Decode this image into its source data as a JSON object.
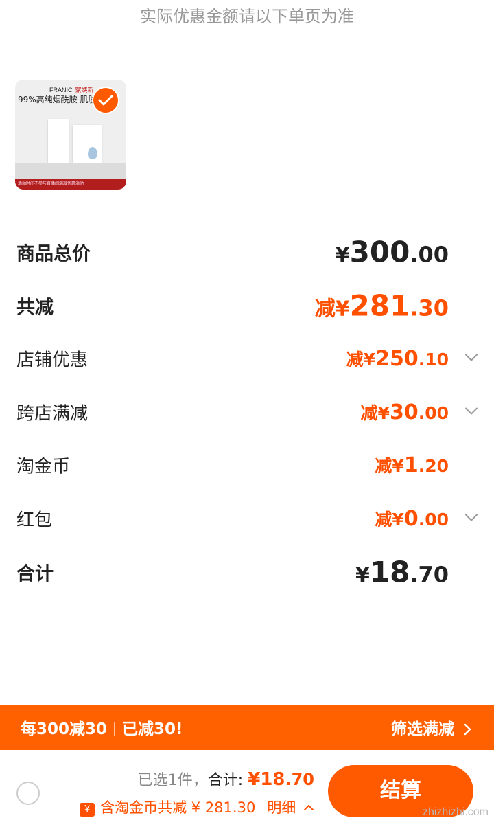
{
  "notice": "实际优惠金额请以下单页为准",
  "product_thumb": {
    "brand": "FRANIC",
    "brand_tag": "家姨新",
    "headline": "99%高纯烟酰胺 肌肤",
    "band_text": "活动时间不参与直播间满减优惠活动",
    "icon": "checkmark-icon",
    "selected": true
  },
  "price_rows": [
    {
      "label": "商品总价",
      "prefix": "",
      "symbol": "¥",
      "int": "300",
      "dec": ".00",
      "style": "black-big",
      "has_dropdown": false
    },
    {
      "label": "共减",
      "prefix": "减",
      "symbol": "¥",
      "int": "281",
      "dec": ".30",
      "style": "orange-big",
      "has_dropdown": false
    },
    {
      "label": "店铺优惠",
      "prefix": "减",
      "symbol": "¥",
      "int": "250",
      "dec": ".10",
      "style": "orange-mid",
      "has_dropdown": true
    },
    {
      "label": "跨店满减",
      "prefix": "减",
      "symbol": "¥",
      "int": "30",
      "dec": ".00",
      "style": "orange-mid",
      "has_dropdown": true
    },
    {
      "label": "淘金币",
      "prefix": "减",
      "symbol": "¥",
      "int": "1",
      "dec": ".20",
      "style": "orange-mid",
      "has_dropdown": false
    },
    {
      "label": "红包",
      "prefix": "减",
      "symbol": "¥",
      "int": "0",
      "dec": ".00",
      "style": "orange-mid",
      "has_dropdown": true
    },
    {
      "label": "合计",
      "prefix": "",
      "symbol": "¥",
      "int": "18",
      "dec": ".70",
      "style": "black-big",
      "has_dropdown": false
    }
  ],
  "promo_bar": {
    "left_1": "每300减30",
    "left_2": "已减30!",
    "right": "筛选满减",
    "right_icon": "chevron-right-icon",
    "color": "#ff6000"
  },
  "footer": {
    "selected_text": "已选1件，",
    "total_label": "合计: ",
    "total_symbol": "¥",
    "total_int": "18",
    "total_dec": ".70",
    "coin_icon_text": "¥",
    "coin_text": "含淘金币共减 ¥ 281.30",
    "detail_label": "明细",
    "detail_icon": "chevron-up-icon",
    "checkout_label": "结算",
    "watermark": "zhizhizhi.com"
  },
  "colors": {
    "accent": "#ff5000",
    "text": "#222222",
    "muted": "#999999"
  }
}
